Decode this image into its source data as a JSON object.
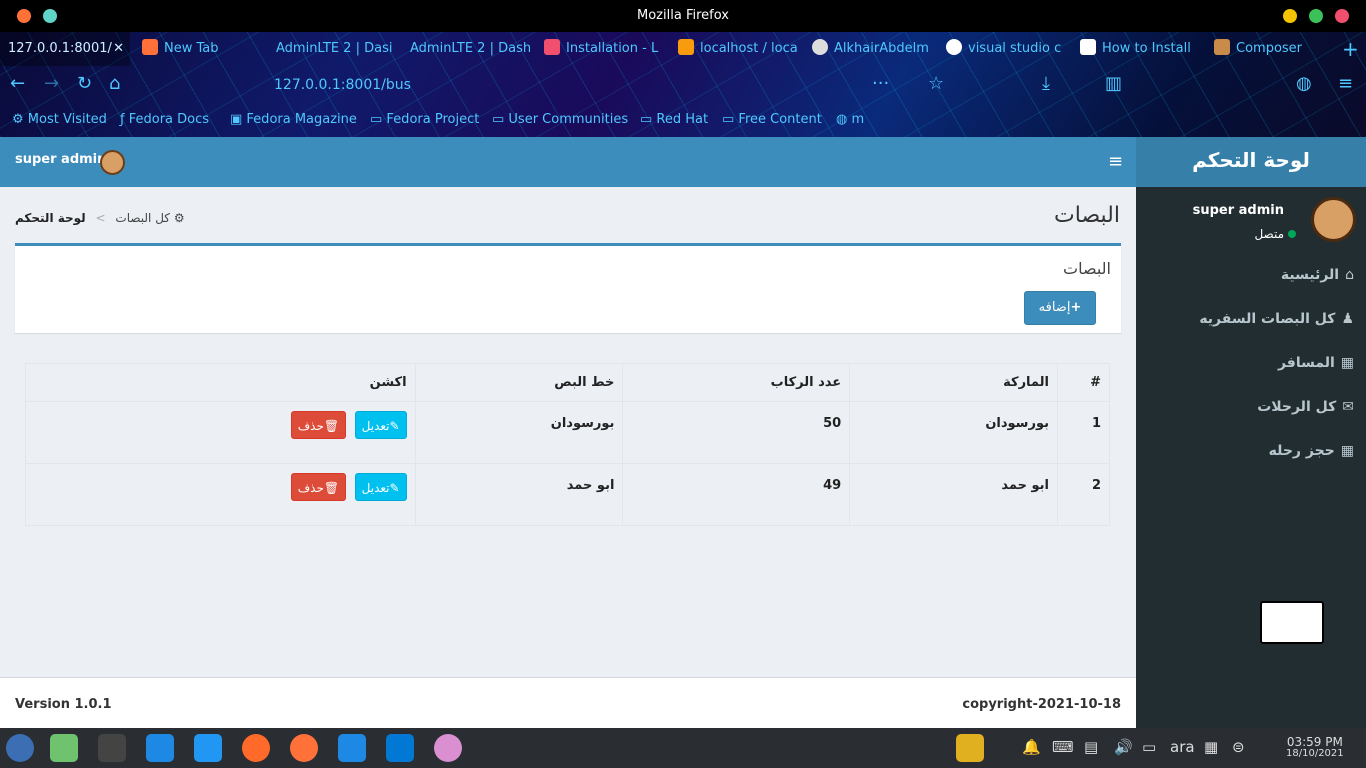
{
  "window": {
    "title": "Mozilla Firefox"
  },
  "tabs": [
    {
      "label": "127.0.0.1:8001/",
      "active": true
    },
    {
      "label": "New Tab"
    },
    {
      "label": "AdminLTE 2 | Dasi"
    },
    {
      "label": "AdminLTE 2 | Dash"
    },
    {
      "label": "Installation - L"
    },
    {
      "label": "localhost / loca"
    },
    {
      "label": "AlkhairAbdelm"
    },
    {
      "label": "visual studio c"
    },
    {
      "label": "How to Install"
    },
    {
      "label": "Composer"
    }
  ],
  "url": "127.0.0.1:8001/bus",
  "bookmarks": [
    "Most Visited",
    "Fedora Docs",
    "Fedora Magazine",
    "Fedora Project",
    "User Communities",
    "Red Hat",
    "Free Content",
    "m"
  ],
  "header": {
    "user": "super admin",
    "logo": "لوحة التحكم"
  },
  "sidebar": {
    "user": "super admin",
    "status": "متصل",
    "items": [
      {
        "label": "الرئيسية",
        "icon": "home-icon"
      },
      {
        "label": "كل البصات السفريه",
        "icon": "users-icon"
      },
      {
        "label": "المسافر",
        "icon": "building-icon"
      },
      {
        "label": "كل الرحلات",
        "icon": "envelope-icon"
      },
      {
        "label": "حجز رحله",
        "icon": "grid-icon"
      }
    ]
  },
  "page": {
    "title": "البصات",
    "breadcrumb_home": "لوحة التحكم",
    "breadcrumb_current": "كل البصات"
  },
  "box": {
    "title": "البصات",
    "add_label": "إضافه"
  },
  "table": {
    "headers": [
      "#",
      "الماركة",
      "عدد الركاب",
      "خط البص",
      "اكشن"
    ],
    "rows": [
      {
        "id": "1",
        "brand": "بورسودان",
        "seats": "50",
        "line": "بورسودان"
      },
      {
        "id": "2",
        "brand": "ابو حمد",
        "seats": "49",
        "line": "ابو حمد"
      }
    ],
    "edit_label": "تعديل",
    "delete_label": "حذف"
  },
  "footer": {
    "version": "Version 1.0.1",
    "copyright": "copyright-2021-10-18"
  },
  "taskbar": {
    "lang": "ara",
    "time": "03:59 PM",
    "date": "18/10/2021"
  },
  "colors": {
    "primary": "#3c8dbc",
    "sidebar": "#222d32",
    "edit": "#00c0ef",
    "delete": "#dd4b39"
  }
}
